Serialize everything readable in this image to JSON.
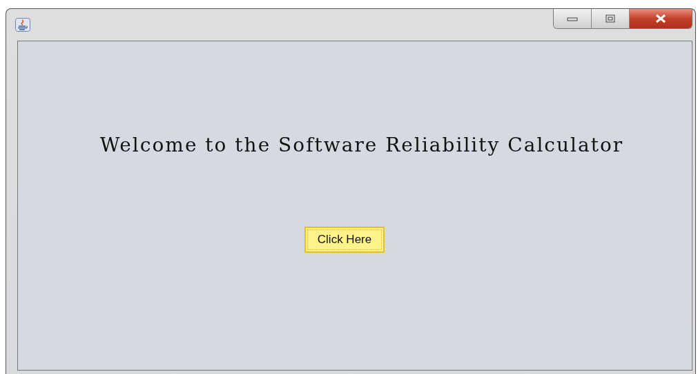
{
  "welcome_text": "Welcome to the Software Reliability Calculator",
  "button": {
    "label": "Click Here"
  }
}
